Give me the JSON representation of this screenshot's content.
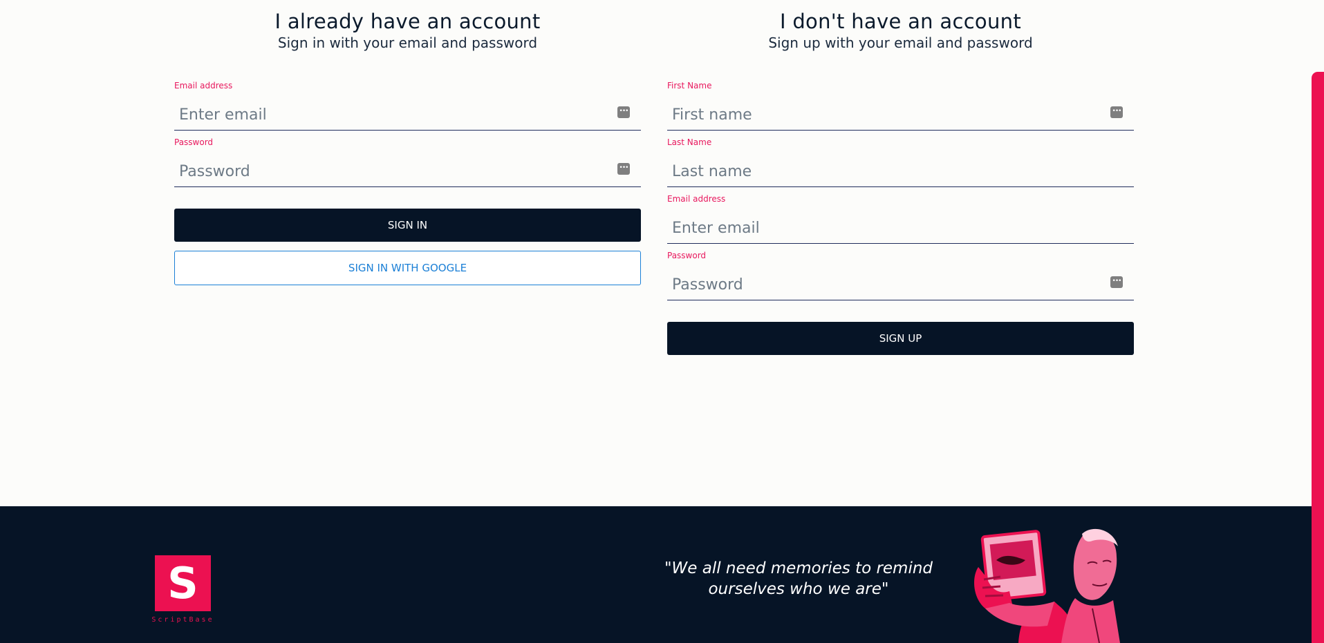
{
  "signin": {
    "title": "I already have an account",
    "subtitle": "Sign in with your email and password",
    "email_label": "Email address",
    "email_placeholder": "Enter email",
    "password_label": "Password",
    "password_placeholder": "Password",
    "signin_button": "SIGN IN",
    "google_button": "SIGN IN WITH GOOGLE"
  },
  "signup": {
    "title": "I don't have an account",
    "subtitle": "Sign up with your email and password",
    "first_name_label": "First Name",
    "first_name_placeholder": "First name",
    "last_name_label": "Last Name",
    "last_name_placeholder": "Last name",
    "email_label": "Email address",
    "email_placeholder": "Enter email",
    "password_label": "Password",
    "password_placeholder": "Password",
    "signup_button": "SIGN UP"
  },
  "footer": {
    "logo_letter": "S",
    "logo_text": "ScriptBase",
    "quote": "\"We all need memories to remind ourselves who we are\""
  },
  "icons": {
    "field_autofill": "password-key-icon"
  },
  "colors": {
    "accent": "#ec1151",
    "label": "#e8175d",
    "dark": "#061426",
    "link": "#1a7fd6",
    "background": "#fcfcfa"
  }
}
